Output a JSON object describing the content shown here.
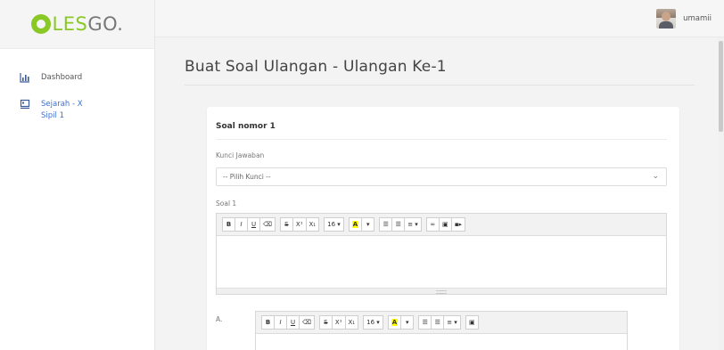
{
  "brand": {
    "logo_text_1": "LES",
    "logo_text_2": "GO."
  },
  "sidebar": {
    "items": [
      {
        "icon": "chart-icon",
        "label": "Dashboard"
      },
      {
        "icon": "book-icon",
        "label": "Sejarah - X Sipil 1"
      }
    ]
  },
  "topbar": {
    "username": "umamii"
  },
  "page": {
    "title": "Buat Soal Ulangan - Ulangan Ke-1"
  },
  "card": {
    "title": "Soal nomor 1",
    "key_label": "Kunci Jawaban",
    "key_select_value": "-- Pilih Kunci --",
    "question_label": "Soal 1",
    "option_label": "A."
  },
  "toolbar": {
    "bold": "B",
    "italic": "I",
    "underline": "U",
    "eraser": "⌫",
    "strike": "S",
    "superscript": "X¹",
    "subscript": "X₁",
    "font_size": "16 ▾",
    "highlight": "A",
    "highlight_caret": "▾",
    "unordered_list": "☰",
    "ordered_list": "☰",
    "align": "≡ ▾",
    "link": "∞",
    "image": "▣",
    "video": "▪▸"
  }
}
